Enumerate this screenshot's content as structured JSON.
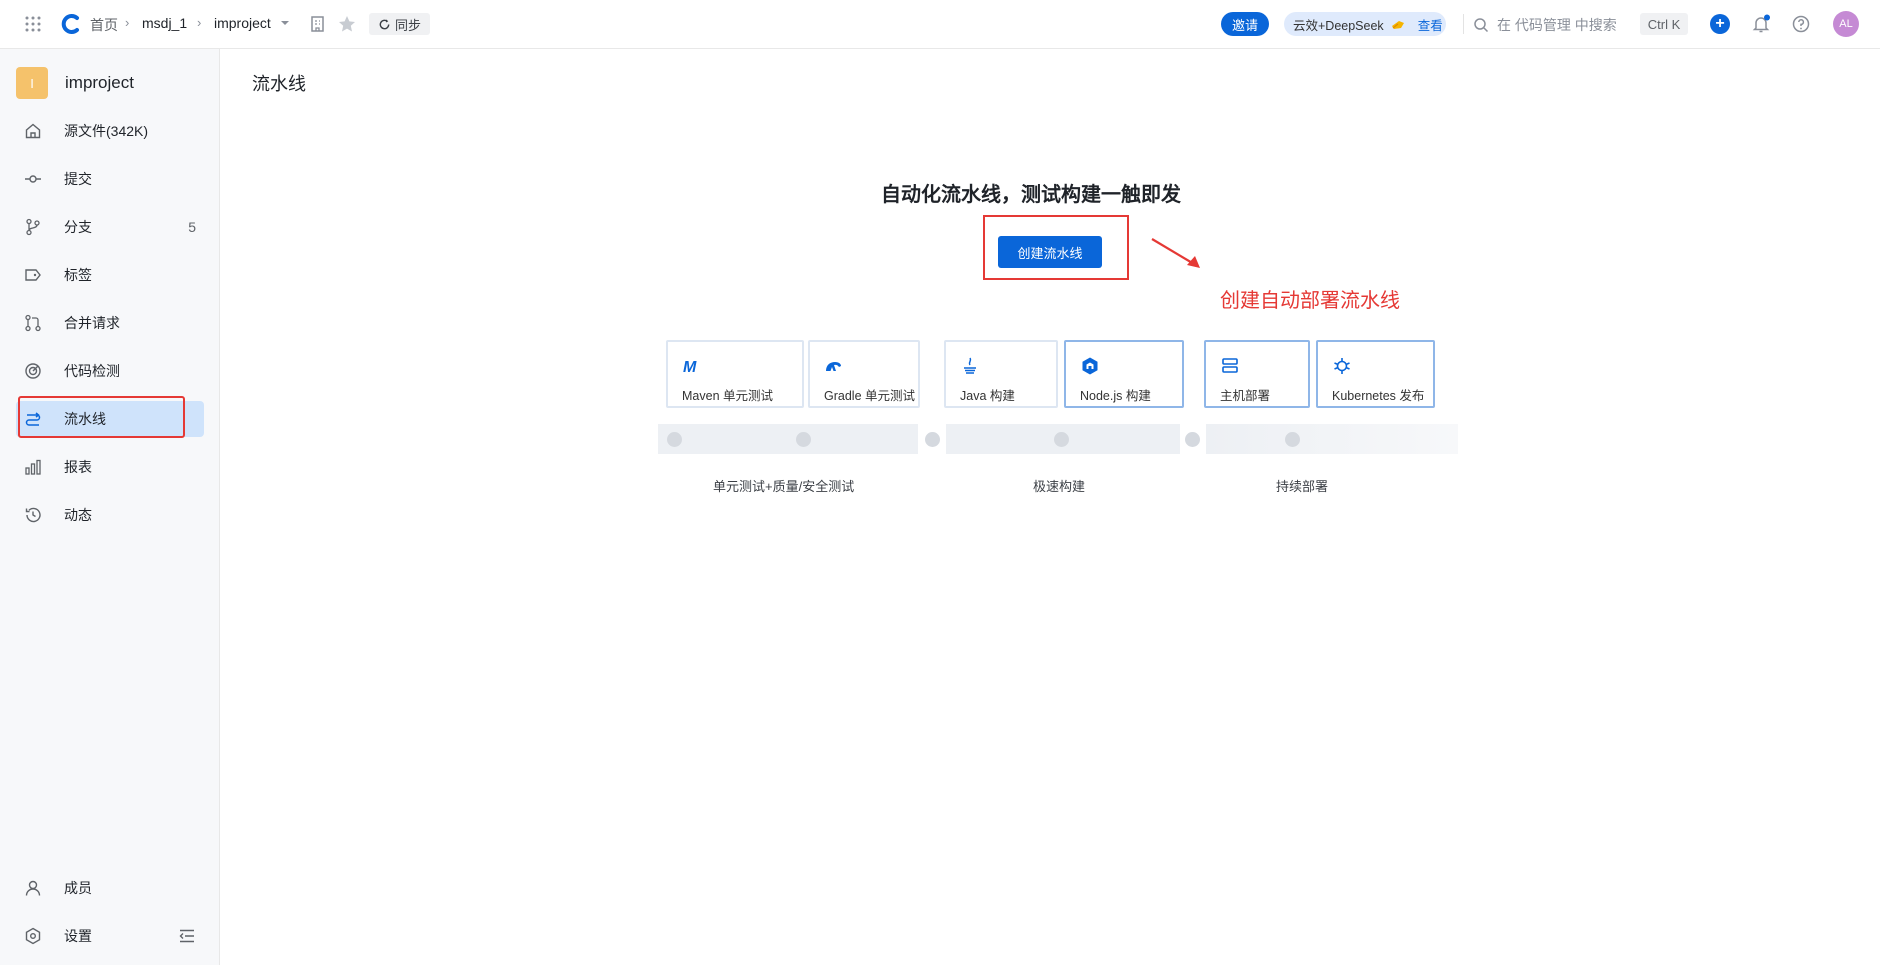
{
  "topbar": {
    "breadcrumb": {
      "home": "首页",
      "org": "msdj_1",
      "repo": "improject"
    },
    "sync_label": "同步",
    "invite_label": "邀请",
    "ai_text": "云效+DeepSeek",
    "ai_view": "查看",
    "search_placeholder": "在 代码管理 中搜索",
    "shortcut": "Ctrl K",
    "avatar_initials": "AL"
  },
  "sidebar": {
    "project": {
      "badge": "I",
      "name": "improject"
    },
    "items": [
      {
        "label": "源文件(342K)",
        "icon": "home-icon"
      },
      {
        "label": "提交",
        "icon": "commit-icon"
      },
      {
        "label": "分支",
        "icon": "branch-icon",
        "count": "5"
      },
      {
        "label": "标签",
        "icon": "tag-icon"
      },
      {
        "label": "合并请求",
        "icon": "merge-request-icon"
      },
      {
        "label": "代码检测",
        "icon": "code-scan-icon"
      },
      {
        "label": "流水线",
        "icon": "pipeline-icon",
        "active": true
      },
      {
        "label": "报表",
        "icon": "chart-icon"
      },
      {
        "label": "动态",
        "icon": "history-icon"
      }
    ],
    "bottom": [
      {
        "label": "成员",
        "icon": "user-icon"
      },
      {
        "label": "设置",
        "icon": "settings-icon"
      }
    ]
  },
  "main": {
    "title": "流水线",
    "headline": "自动化流水线，测试构建一触即发",
    "create_button": "创建流水线",
    "annotation": "创建自动部署流水线",
    "cards": [
      {
        "label": "Maven 单元测试",
        "icon": "maven-icon"
      },
      {
        "label": "Gradle 单元测试",
        "icon": "gradle-icon"
      },
      {
        "label": "Java 构建",
        "icon": "java-icon"
      },
      {
        "label": "Node.js 构建",
        "icon": "nodejs-icon"
      },
      {
        "label": "主机部署",
        "icon": "server-icon"
      },
      {
        "label": "Kubernetes 发布",
        "icon": "kubernetes-icon"
      }
    ],
    "stages": [
      "单元测试+质量/安全测试",
      "极速构建",
      "持续部署"
    ]
  },
  "colors": {
    "primary": "#0a66d9",
    "annotation": "#e53935",
    "active_bg": "#cfe3fb"
  }
}
